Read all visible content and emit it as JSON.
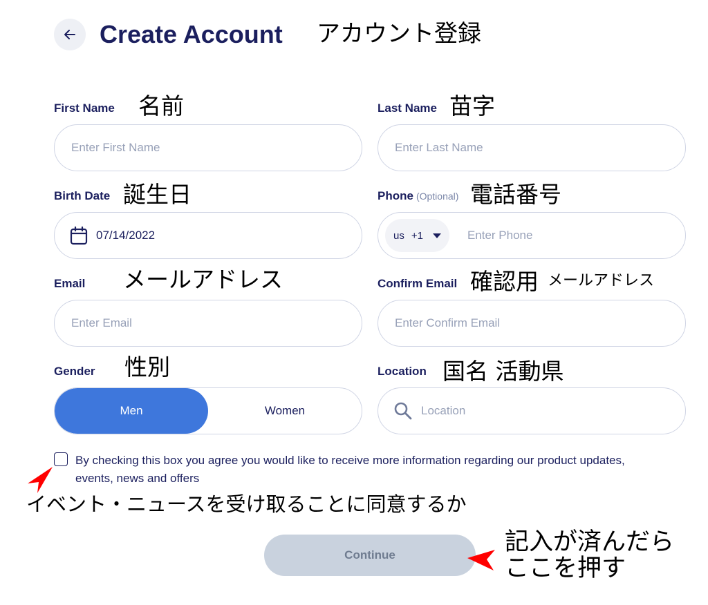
{
  "header": {
    "title": "Create Account",
    "title_jp": "アカウント登録"
  },
  "fields": {
    "first_name": {
      "label": "First Name",
      "note_jp": "名前",
      "placeholder": "Enter First Name"
    },
    "last_name": {
      "label": "Last Name",
      "note_jp": "苗字",
      "placeholder": "Enter Last Name"
    },
    "birth_date": {
      "label": "Birth Date",
      "note_jp": "誕生日",
      "value": "07/14/2022"
    },
    "phone": {
      "label": "Phone",
      "optional": "(Optional)",
      "note_jp": "電話番号",
      "country": "us",
      "code": "+1",
      "placeholder": "Enter Phone"
    },
    "email": {
      "label": "Email",
      "note_jp": "メールアドレス",
      "placeholder": "Enter Email"
    },
    "confirm_email": {
      "label": "Confirm Email",
      "note_jp": "確認用",
      "note_jp_small": "メールアドレス",
      "placeholder": "Enter Confirm Email"
    },
    "gender": {
      "label": "Gender",
      "note_jp": "性別",
      "options": [
        "Men",
        "Women"
      ],
      "selected": "Men"
    },
    "location": {
      "label": "Location",
      "note_jp": "国名 活動県",
      "placeholder": "Location"
    }
  },
  "consent": {
    "text": "By checking this box you agree you would like to receive more information regarding our product updates, events, news and offers",
    "note_jp": "イベント・ニュースを受け取ることに同意するか",
    "checked": false
  },
  "continue": {
    "label": "Continue",
    "note_jp_line1": "記入が済んだら",
    "note_jp_line2": "ここを押す"
  },
  "colors": {
    "primary_text": "#1b1f5e",
    "accent": "#3e77dc",
    "annotation_arrow": "#ff0000",
    "disabled_button": "#c9d2de"
  },
  "icons": [
    "arrow-left-icon",
    "calendar-icon",
    "caret-down-icon",
    "search-icon"
  ]
}
